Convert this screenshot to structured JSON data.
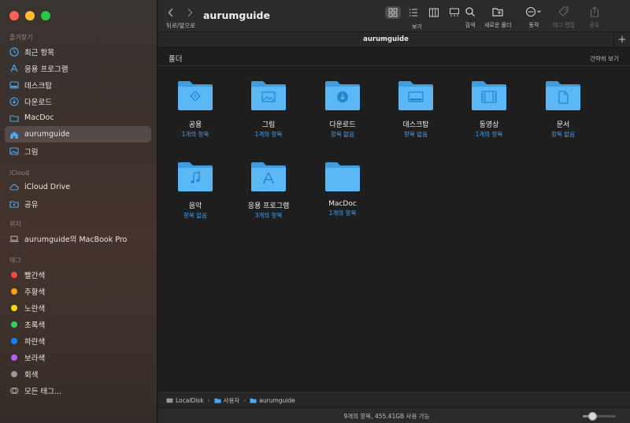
{
  "window": {
    "title": "aurumguide",
    "tab_title": "aurumguide"
  },
  "toolbar": {
    "nav_label": "뒤로/앞으로",
    "view_label": "보기",
    "search_label": "검색",
    "new_folder_label": "새로운 폴더",
    "action_label": "동작",
    "edit_tags_label": "태그 편집",
    "share_label": "공유"
  },
  "sidebar": {
    "favorites_header": "즐겨찾기",
    "favorites": [
      {
        "label": "최근 항목",
        "icon": "clock-icon"
      },
      {
        "label": "응용 프로그램",
        "icon": "applications-icon"
      },
      {
        "label": "데스크탑",
        "icon": "desktop-icon"
      },
      {
        "label": "다운로드",
        "icon": "download-icon"
      },
      {
        "label": "MacDoc",
        "icon": "folder-icon"
      },
      {
        "label": "aurumguide",
        "icon": "home-icon"
      },
      {
        "label": "그림",
        "icon": "pictures-icon"
      }
    ],
    "icloud_header": "iCloud",
    "icloud": [
      {
        "label": "iCloud Drive",
        "icon": "cloud-icon"
      },
      {
        "label": "공유",
        "icon": "shared-folder-icon"
      }
    ],
    "locations_header": "위치",
    "locations": [
      {
        "label": "aurumguide의 MacBook Pro",
        "icon": "laptop-icon"
      }
    ],
    "tags_header": "태그",
    "tags": [
      {
        "label": "빨간색",
        "color": "#ff453a"
      },
      {
        "label": "주황색",
        "color": "#ff9f0a"
      },
      {
        "label": "노란색",
        "color": "#ffd60a"
      },
      {
        "label": "초록색",
        "color": "#30d158"
      },
      {
        "label": "파란색",
        "color": "#0a84ff"
      },
      {
        "label": "보라색",
        "color": "#bf5af2"
      },
      {
        "label": "회색",
        "color": "#98989d"
      }
    ],
    "all_tags_label": "모든 태그..."
  },
  "content": {
    "group_title": "폴더",
    "group_action": "간략히 보기",
    "items": [
      {
        "name": "공용",
        "sub": "1개의 항목",
        "icon": "public-folder-icon"
      },
      {
        "name": "그림",
        "sub": "1개의 항목",
        "icon": "pictures-folder-icon"
      },
      {
        "name": "다운로드",
        "sub": "항목 없음",
        "icon": "downloads-folder-icon"
      },
      {
        "name": "데스크탑",
        "sub": "항목 없음",
        "icon": "desktop-folder-icon"
      },
      {
        "name": "동영상",
        "sub": "1개의 항목",
        "icon": "movies-folder-icon"
      },
      {
        "name": "문서",
        "sub": "항목 없음",
        "icon": "documents-folder-icon"
      },
      {
        "name": "음악",
        "sub": "항목 없음",
        "icon": "music-folder-icon"
      },
      {
        "name": "응용 프로그램",
        "sub": "3개의 항목",
        "icon": "applications-folder-icon"
      },
      {
        "name": "MacDoc",
        "sub": "1개의 항목",
        "icon": "plain-folder-icon"
      }
    ]
  },
  "pathbar": {
    "items": [
      "LocalDisk",
      "사용자",
      "aurumguide"
    ]
  },
  "status": {
    "text": "9개의 항목, 455.41GB 사용 가능",
    "icon_size": 0.3
  },
  "colors": {
    "accent": "#4aa8f2",
    "folder": "#5bb8f5"
  }
}
